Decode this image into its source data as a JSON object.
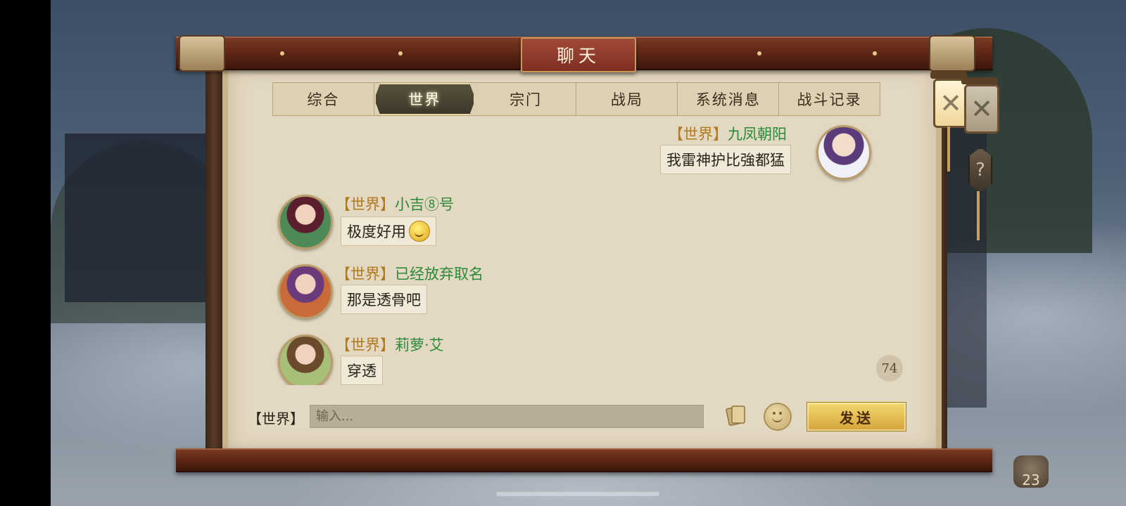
{
  "window": {
    "title": "聊天"
  },
  "tabs": [
    {
      "label": "综合",
      "active": false
    },
    {
      "label": "世界",
      "active": true
    },
    {
      "label": "宗门",
      "active": false
    },
    {
      "label": "战局",
      "active": false
    },
    {
      "label": "系统消息",
      "active": false
    },
    {
      "label": "战斗记录",
      "active": false
    }
  ],
  "messages": [
    {
      "channel": "【世界】",
      "user": "九凤朝阳",
      "text": "我雷神护比強都猛",
      "side": "right"
    },
    {
      "channel": "【世界】",
      "user": "小吉⑧号",
      "text": "极度好用",
      "emoji": "smile",
      "side": "left"
    },
    {
      "channel": "【世界】",
      "user": "已经放弃取名",
      "text": "那是透骨吧",
      "side": "left"
    },
    {
      "channel": "【世界】",
      "user": "莉萝·艾",
      "text": "穿透",
      "side": "left"
    }
  ],
  "unread_count": "74",
  "input": {
    "channel_label": "【世界】",
    "placeholder": "输入..."
  },
  "send_label": "发送",
  "corner_counter": "23",
  "colors": {
    "channel": "#b07a1e",
    "username": "#2a8a3a",
    "title_plaque": "#8e3a2a",
    "send_button": "#e8c24e"
  }
}
